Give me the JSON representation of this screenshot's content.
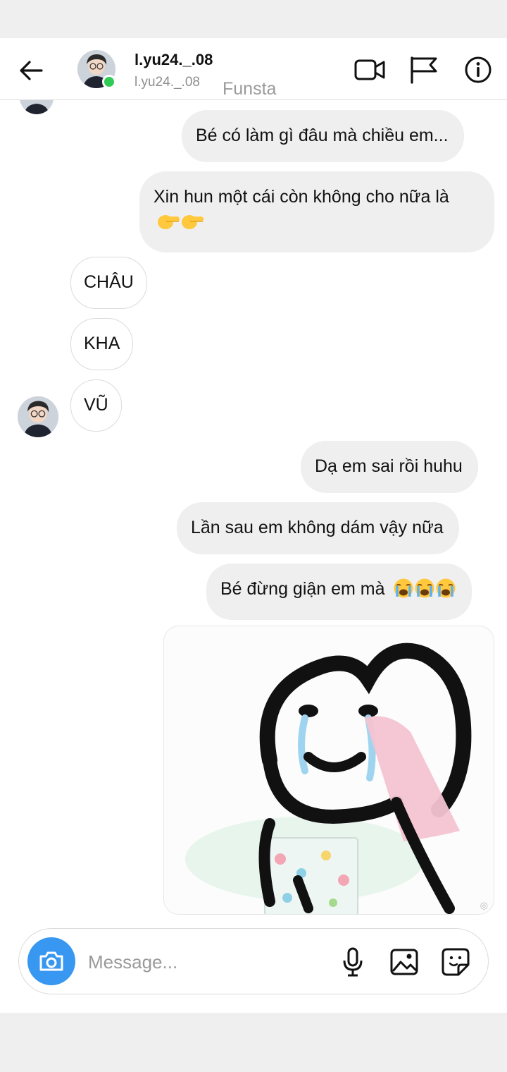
{
  "header": {
    "name": "l.yu24._.08",
    "username": "l.yu24._.08",
    "tag": "Funsta",
    "icons": [
      "back-arrow-icon",
      "video-call-icon",
      "flag-icon",
      "info-icon"
    ]
  },
  "messages": [
    {
      "direction": "sent",
      "text": "Bé có làm gì đâu mà chiều em..."
    },
    {
      "direction": "sent",
      "text": "Xin hun một cái còn không cho nữa là",
      "emoji": [
        "backhand-index-pointing-right",
        "backhand-index-pointing-right"
      ]
    },
    {
      "direction": "received",
      "text": "CHÂU"
    },
    {
      "direction": "received",
      "text": "KHA"
    },
    {
      "direction": "received",
      "text": "VŨ"
    },
    {
      "direction": "sent",
      "text": "Dạ em sai rồi huhu"
    },
    {
      "direction": "sent",
      "text": "Lần sau em không dám vậy  nữa"
    },
    {
      "direction": "sent",
      "text": "Bé đừng giận em mà",
      "emoji": [
        "loudly-crying-face",
        "loudly-crying-face",
        "loudly-crying-face"
      ]
    },
    {
      "direction": "sent",
      "type": "image",
      "description": "crying stick figure sticker wiping tears with a pink tissue"
    }
  ],
  "composer": {
    "placeholder": "Message...",
    "icons": [
      "camera-icon",
      "microphone-icon",
      "gallery-icon",
      "sticker-icon"
    ]
  },
  "colors": {
    "online": "#2ecc55",
    "camera_button": "#3897f0",
    "bubble_sent": "#efefef",
    "bubble_received_border": "#dbdbdb"
  }
}
